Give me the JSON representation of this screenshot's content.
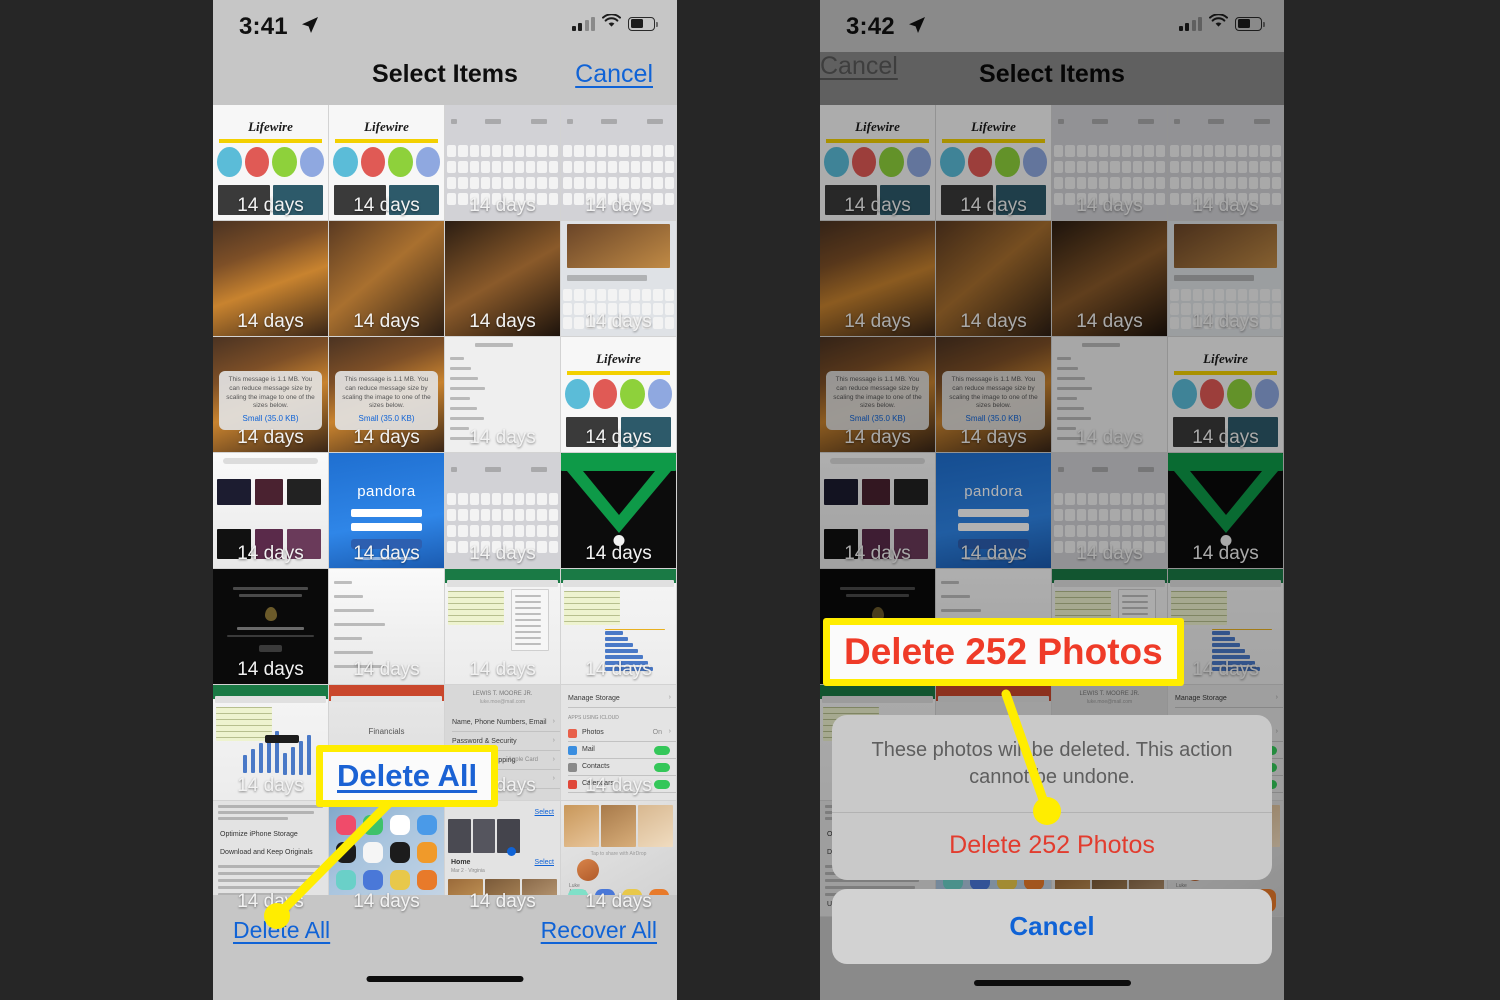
{
  "background_color": "#262626",
  "accent_blue": "#1063d6",
  "destructive_red": "#e23c2e",
  "callout_yellow": "#ffed00",
  "panels": [
    {
      "id": "left",
      "status_bar": {
        "time": "3:41",
        "location_icon": "location-arrow-icon",
        "cellular_icon": "cellular-bars-icon",
        "wifi_icon": "wifi-icon",
        "battery_icon": "battery-icon"
      },
      "nav": {
        "title": "Select Items",
        "action_label": "Cancel"
      },
      "grid": {
        "badge_label": "14 days",
        "rows": 7,
        "columns": 4
      },
      "bottom_bar": {
        "delete_label": "Delete All",
        "recover_label": "Recover All"
      },
      "callout": {
        "text": "Delete All",
        "style": "blue-underline"
      }
    },
    {
      "id": "right",
      "status_bar": {
        "time": "3:42",
        "location_icon": "location-arrow-icon",
        "cellular_icon": "cellular-bars-icon",
        "wifi_icon": "wifi-icon",
        "battery_icon": "battery-icon"
      },
      "nav": {
        "title": "Select Items",
        "action_label": "Cancel"
      },
      "grid": {
        "badge_label": "14 days",
        "rows": 7,
        "columns": 4
      },
      "action_sheet": {
        "message": "These photos will be deleted. This action cannot be undone.",
        "destructive_label": "Delete 252 Photos",
        "cancel_label": "Cancel"
      },
      "callout": {
        "text": "Delete 252 Photos",
        "style": "red"
      }
    }
  ]
}
